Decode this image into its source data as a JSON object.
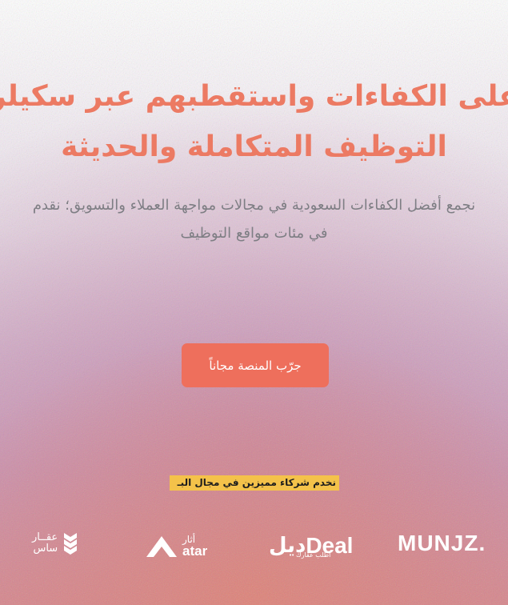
{
  "hero": {
    "title_line1": "على الكفاءات واستقطبهم عبر سكيلر",
    "title_line2": "التوظيف المتكاملة والحديثة",
    "subtitle_line1": "نجمع أفضل الكفاءات السعودية في مجالات مواجهة العملاء والتسويق؛ نقدم",
    "subtitle_line2": "في مئات مواقع التوظيف",
    "cta_label": "جرّب المنصة مجاناً"
  },
  "partners": {
    "heading": "نخدم شركاء مميزين في مجال البـ",
    "logos": {
      "munjz": "MUNJZ.",
      "deal_main": "Deal",
      "deal_ar": "ديل",
      "deal_sub": "اطلب عقارك",
      "athar_ar": "أثار",
      "athar_en": "atar",
      "aqar_line1": "عقــار",
      "aqar_line2": "ساس"
    }
  },
  "colors": {
    "accent": "#ec7a63",
    "button": "#ee6f5c",
    "highlight": "#f4c24a",
    "subtitle": "#7e7e84"
  }
}
